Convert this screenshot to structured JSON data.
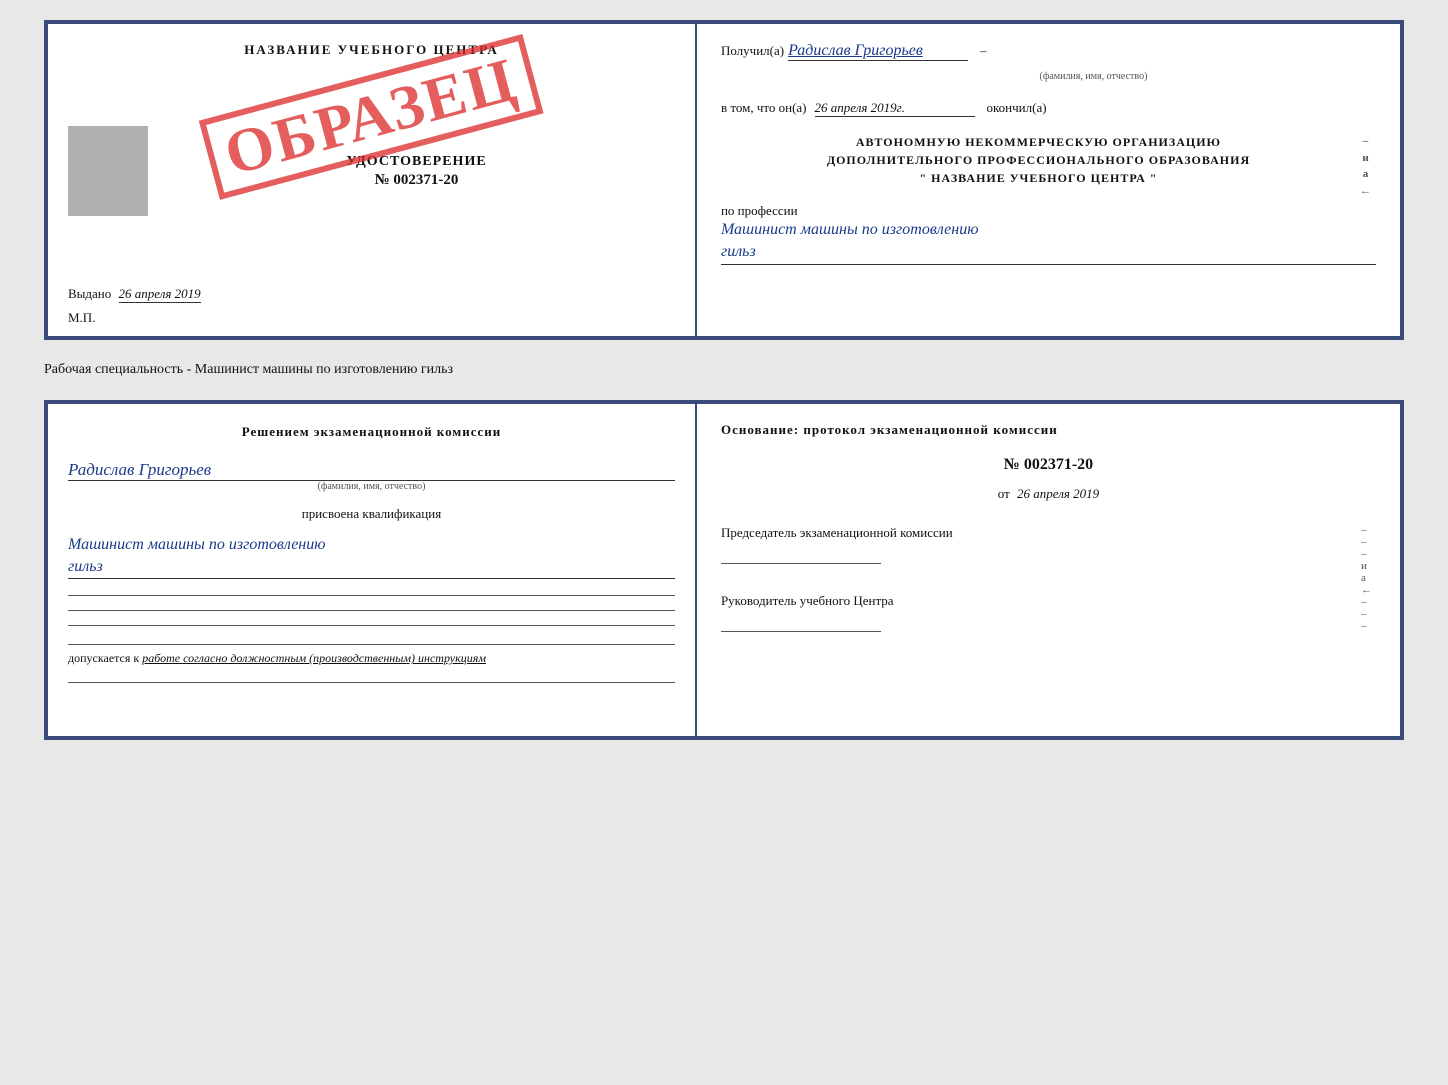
{
  "topLeft": {
    "title": "НАЗВАНИЕ УЧЕБНОГО ЦЕНТРА",
    "stampText": "ОБРАЗЕЦ",
    "udostLabel": "УДОСТОВЕРЕНИЕ",
    "udostNumber": "№ 002371-20",
    "vydanoLabel": "Выдано",
    "vydanoDate": "26 апреля 2019",
    "mpLabel": "М.П."
  },
  "topRight": {
    "poluchilLabel": "Получил(а)",
    "poluchilValue": "Радислав Григорьев",
    "famSub": "(фамилия, имя, отчество)",
    "vtomLabel": "в том, что он(а)",
    "vtomDate": "26 апреля 2019г.",
    "okonchilLabel": "окончил(а)",
    "orgLine1": "АВТОНОМНУЮ НЕКОММЕРЧЕСКУЮ ОРГАНИЗАЦИЮ",
    "orgLine2": "ДОПОЛНИТЕЛЬНОГО ПРОФЕССИОНАЛЬНОГО ОБРАЗОВАНИЯ",
    "orgLine3": "\"     НАЗВАНИЕ УЧЕБНОГО ЦЕНТРА     \"",
    "iPredlLabel": "и",
    "apostrLabel": "а",
    "chevLabel": "←",
    "poProf": "по профессии",
    "profValue1": "Машинист машины по изготовлению",
    "profValue2": "гильз"
  },
  "separatorLabel": "Рабочая специальность - Машинист машины по изготовлению гильз",
  "bottomLeft": {
    "commTitle": "Решением  экзаменационной  комиссии",
    "personName": "Радислав Григорьев",
    "nameSub": "(фамилия, имя, отчество)",
    "assignedLabel": "присвоена квалификация",
    "qualValue1": "Машинист машины по изготовлению",
    "qualValue2": "гильз",
    "dopuskaetsyaLabel": "допускается к",
    "workText": "работе согласно должностным (производственным) инструкциям"
  },
  "bottomRight": {
    "osnovanieTitle": "Основание: протокол экзаменационной  комиссии",
    "protocolNumber": "№  002371-20",
    "ot": "от",
    "date": "26 апреля 2019",
    "predsedatelTitle": "Председатель экзаменационной комиссии",
    "rukovoditelTitle": "Руководитель учебного Центра",
    "iLabel": "и",
    "aLabel": "а",
    "chevLabel": "←"
  },
  "dashes": [
    "-",
    "-",
    "-",
    "-",
    "-",
    "-",
    "-"
  ]
}
